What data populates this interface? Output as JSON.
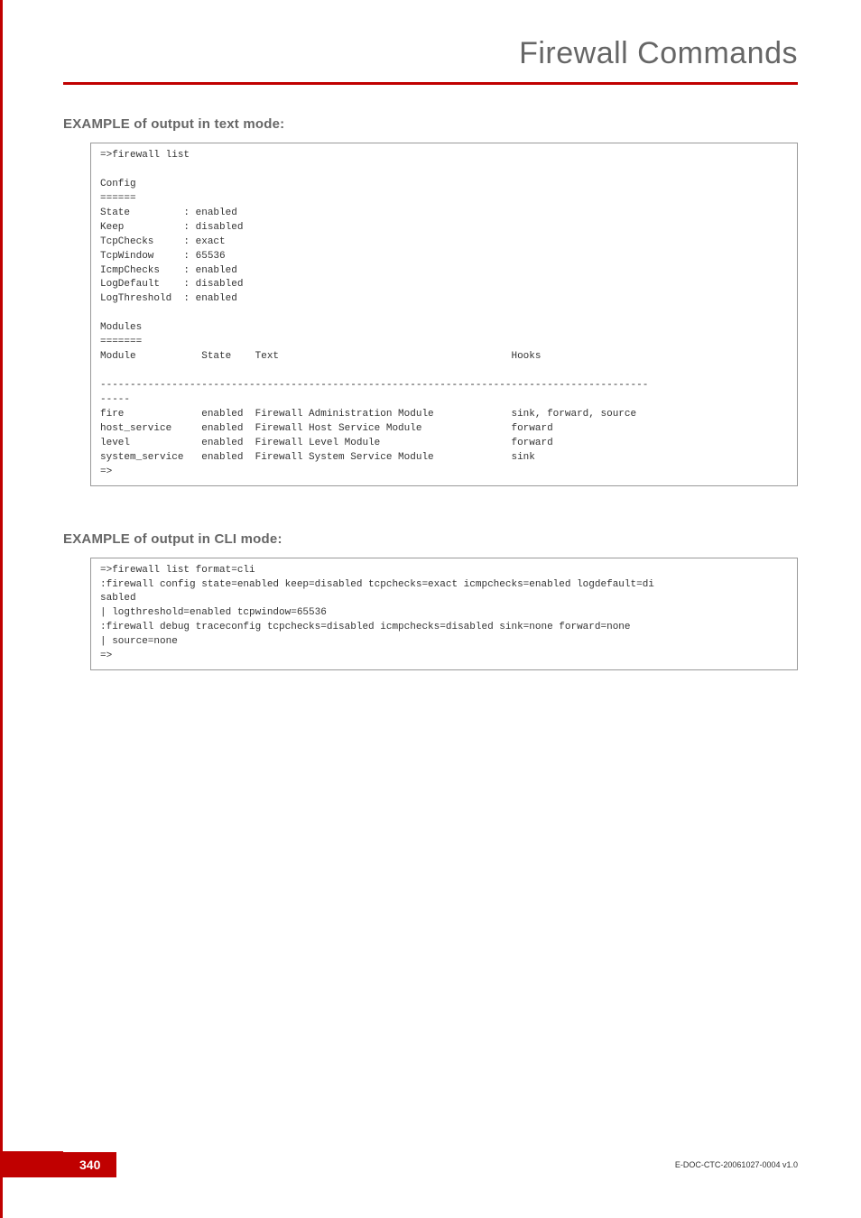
{
  "header": {
    "title": "Firewall Commands"
  },
  "sections": {
    "text_mode": {
      "heading": "EXAMPLE of output in text mode:",
      "code": "=>firewall list\n\nConfig\n======\nState         : enabled\nKeep          : disabled\nTcpChecks     : exact\nTcpWindow     : 65536\nIcmpChecks    : enabled\nLogDefault    : disabled\nLogThreshold  : enabled\n\nModules\n=======\nModule           State    Text                                       Hooks\n\n--------------------------------------------------------------------------------------------\n-----\nfire             enabled  Firewall Administration Module             sink, forward, source\nhost_service     enabled  Firewall Host Service Module               forward\nlevel            enabled  Firewall Level Module                      forward\nsystem_service   enabled  Firewall System Service Module             sink\n=>"
    },
    "cli_mode": {
      "heading": "EXAMPLE of output in CLI mode:",
      "code": "=>firewall list format=cli\n:firewall config state=enabled keep=disabled tcpchecks=exact icmpchecks=enabled logdefault=di\nsabled\n| logthreshold=enabled tcpwindow=65536\n:firewall debug traceconfig tcpchecks=disabled icmpchecks=disabled sink=none forward=none\n| source=none\n=>"
    }
  },
  "footer": {
    "page_number": "340",
    "doc_id": "E-DOC-CTC-20061027-0004 v1.0"
  }
}
